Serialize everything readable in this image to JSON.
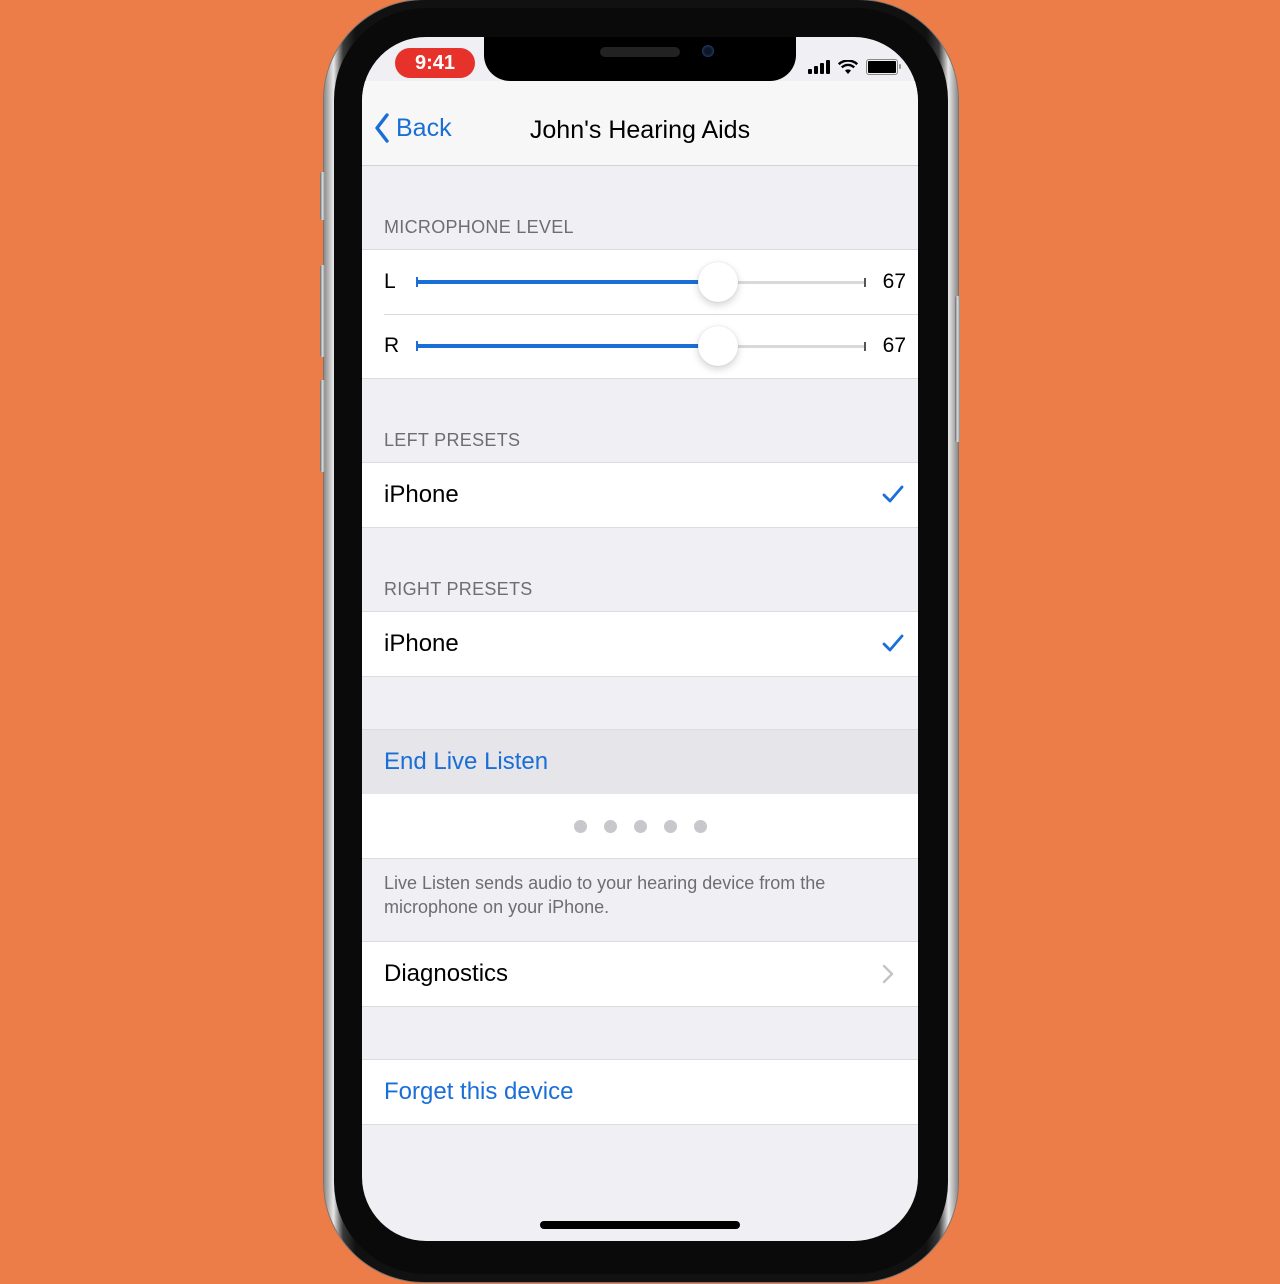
{
  "status_bar": {
    "time": "9:41",
    "time_pill_color": "#e7312b",
    "signal_icon": "cellular-signal-icon",
    "wifi_icon": "wifi-icon",
    "battery_icon": "battery-icon"
  },
  "nav": {
    "back_label": "Back",
    "title": "John's Hearing Aids"
  },
  "accent_color": "#1a6fd6",
  "microphone_level": {
    "header": "MICROPHONE LEVEL",
    "sliders": [
      {
        "channel": "L",
        "value": "67",
        "fraction": 0.67
      },
      {
        "channel": "R",
        "value": "67",
        "fraction": 0.67
      }
    ]
  },
  "left_presets": {
    "header": "LEFT PRESETS",
    "items": [
      {
        "label": "iPhone",
        "selected": true
      }
    ]
  },
  "right_presets": {
    "header": "RIGHT PRESETS",
    "items": [
      {
        "label": "iPhone",
        "selected": true
      }
    ]
  },
  "live_listen": {
    "end_label": "End Live Listen",
    "level_dots": 5,
    "footer": "Live Listen sends audio to your hearing device from the microphone on your iPhone."
  },
  "diagnostics": {
    "label": "Diagnostics"
  },
  "forget": {
    "label": "Forget this device"
  }
}
